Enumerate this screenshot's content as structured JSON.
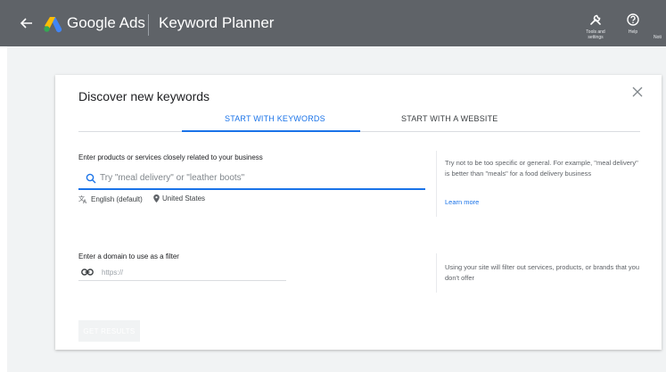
{
  "topbar": {
    "brand": "Google Ads",
    "product": "Keyword Planner",
    "tools_label": "Tools and settings",
    "help_label": "Help",
    "notifications_label": "Noti",
    "icons": {
      "back": "arrow-left-icon",
      "logo": "google-ads-logo",
      "tools": "wrench-icon",
      "help": "help-circle-icon"
    }
  },
  "dialog": {
    "title": "Discover new keywords",
    "tabs": [
      {
        "label": "START WITH KEYWORDS",
        "active": true
      },
      {
        "label": "START WITH A WEBSITE",
        "active": false
      }
    ],
    "keywords": {
      "label": "Enter products or services closely related to your business",
      "placeholder": "Try \"meal delivery\" or \"leather boots\"",
      "language": "English (default)",
      "location": "United States",
      "help": "Try not to be too specific or general. For example, \"meal delivery\" is better than \"meals\" for a food delivery business",
      "learn_more": "Learn more"
    },
    "domain": {
      "label": "Enter a domain to use as a filter",
      "placeholder": "https://",
      "help": "Using your site will filter out services, products, or brands that you don't offer"
    },
    "submit_label": "GET RESULTS"
  },
  "colors": {
    "topbar": "#5f6368",
    "accent": "#1a73e8",
    "page_bg": "#f1f3f4"
  }
}
